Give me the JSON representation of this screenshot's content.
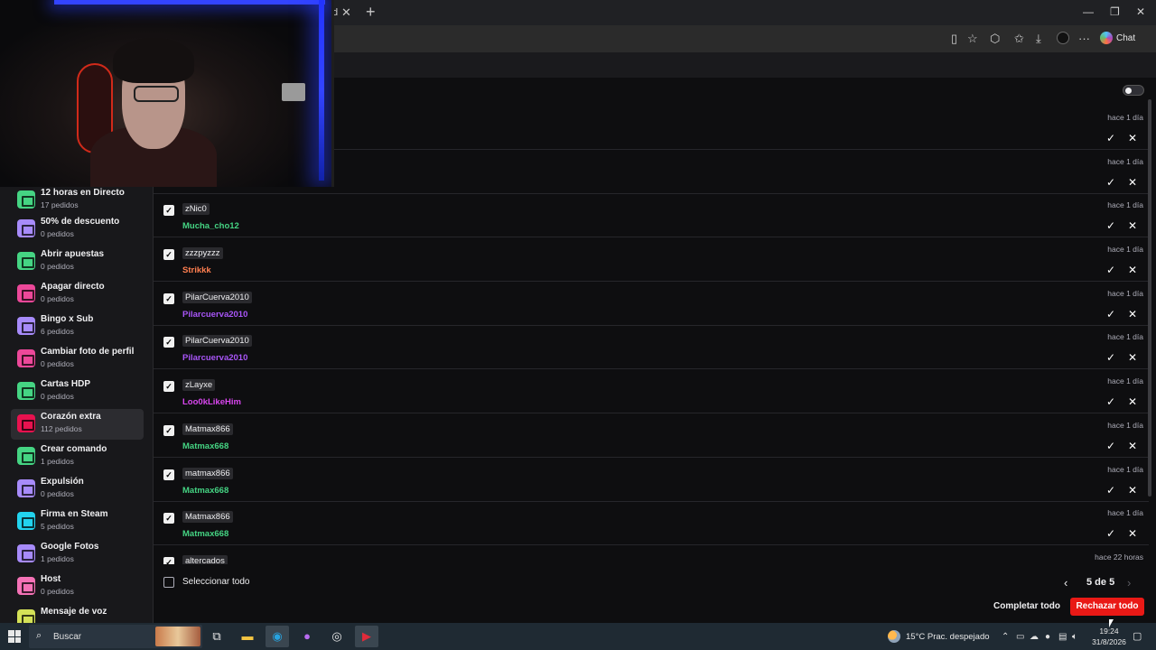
{
  "browser": {
    "tab_fragment": "d",
    "tab_close": "✕",
    "new_tab": "+",
    "chat_label": "Chat",
    "minimize": "—",
    "restore": "❐",
    "close": "✕",
    "more": "···"
  },
  "sidebar": {
    "items": [
      {
        "title": "12 horas en Directo",
        "sub": "17 pedidos",
        "color": "#45d483"
      },
      {
        "title": "50% de descuento",
        "sub": "0 pedidos",
        "color": "#a78bfa"
      },
      {
        "title": "Abrir apuestas",
        "sub": "0 pedidos",
        "color": "#45d483"
      },
      {
        "title": "Apagar directo",
        "sub": "0 pedidos",
        "color": "#ec4899"
      },
      {
        "title": "Bingo x Sub",
        "sub": "6 pedidos",
        "color": "#a78bfa"
      },
      {
        "title": "Cambiar foto de perfil",
        "sub": "0 pedidos",
        "color": "#ec4899"
      },
      {
        "title": "Cartas HDP",
        "sub": "0 pedidos",
        "color": "#45d483"
      },
      {
        "title": "Corazón extra",
        "sub": "112 pedidos",
        "color": "#e8124f"
      },
      {
        "title": "Crear comando",
        "sub": "1 pedidos",
        "color": "#45d483"
      },
      {
        "title": "Expulsión",
        "sub": "0 pedidos",
        "color": "#a78bfa"
      },
      {
        "title": "Firma en Steam",
        "sub": "5 pedidos",
        "color": "#22d3ee"
      },
      {
        "title": "Google Fotos",
        "sub": "1 pedidos",
        "color": "#a78bfa"
      },
      {
        "title": "Host",
        "sub": "0 pedidos",
        "color": "#f472b6"
      },
      {
        "title": "Mensaje de voz",
        "sub": "",
        "color": "#d4e157"
      }
    ]
  },
  "requests": [
    {
      "reward": "",
      "user": "",
      "user_color": "#45d483",
      "time": "hace 1 día"
    },
    {
      "reward": "",
      "user": "",
      "user_color": "#45d483",
      "time": "hace 1 día"
    },
    {
      "reward": "zNic0",
      "user": "Mucha_cho12",
      "user_color": "#45d483",
      "time": "hace 1 día"
    },
    {
      "reward": "zzzpyzzz",
      "user": "Strikkk",
      "user_color": "#ff7f50",
      "time": "hace 1 día"
    },
    {
      "reward": "PilarCuerva2010",
      "user": "Pilarcuerva2010",
      "user_color": "#a855f7",
      "time": "hace 1 día"
    },
    {
      "reward": "PilarCuerva2010",
      "user": "Pilarcuerva2010",
      "user_color": "#a855f7",
      "time": "hace 1 día"
    },
    {
      "reward": "zLayxe",
      "user": "Loo0kLikeHim",
      "user_color": "#d946ef",
      "time": "hace 1 día"
    },
    {
      "reward": "Matmax866",
      "user": "Matmax668",
      "user_color": "#45d483",
      "time": "hace 1 día"
    },
    {
      "reward": "matmax866",
      "user": "Matmax668",
      "user_color": "#45d483",
      "time": "hace 1 día"
    },
    {
      "reward": "Matmax866",
      "user": "Matmax668",
      "user_color": "#45d483",
      "time": "hace 1 día"
    },
    {
      "reward": "altercados",
      "user": "",
      "user_color": "#45d483",
      "time": "hace 22 horas"
    }
  ],
  "footer": {
    "select_all": "Seleccionar todo",
    "prev": "‹",
    "next": "›",
    "page": "5 de 5",
    "complete_all": "Completar todo",
    "reject_all": "Rechazar todo"
  },
  "taskbar": {
    "search_label": "Buscar",
    "weather": "15°C  Prac. despejado",
    "time": "19:24",
    "date": "31/8/2026"
  },
  "colors": {
    "accent_red": "#e91916",
    "background": "#0e0e10",
    "sidebar": "#18181b"
  }
}
